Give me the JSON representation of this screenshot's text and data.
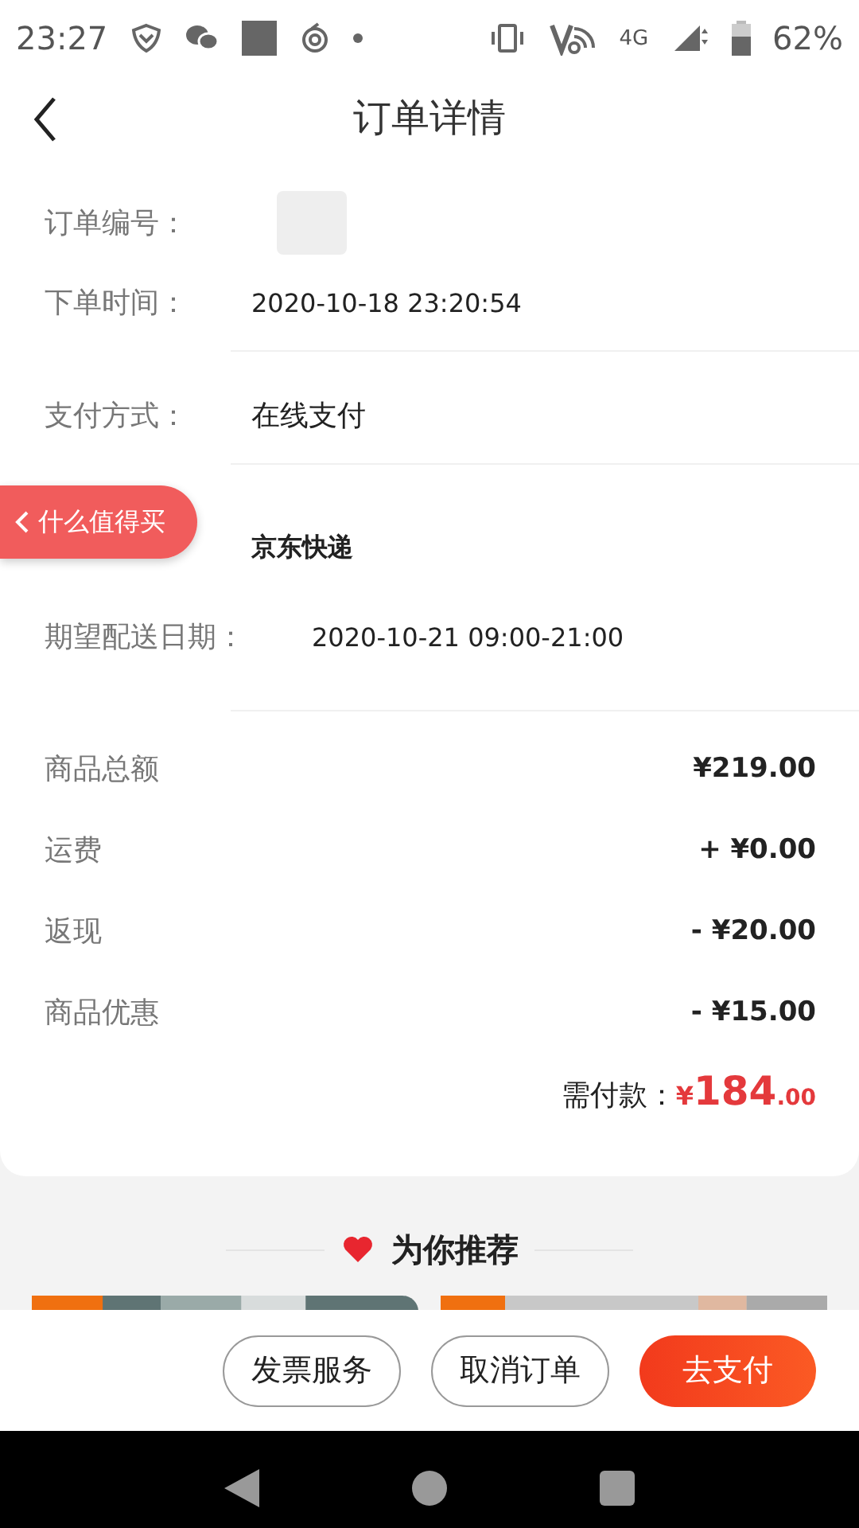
{
  "status_bar": {
    "time": "23:27",
    "network_type": "4G",
    "battery": "62%"
  },
  "header": {
    "title": "订单详情"
  },
  "details": {
    "groups": [
      [
        {
          "label": "订单编号：",
          "kind": "redacted"
        },
        {
          "label": "下单时间：",
          "value": "2020-10-18 23:20:54",
          "kind": "text"
        }
      ],
      [
        {
          "label": "支付方式：",
          "value": "在线支付",
          "kind": "plain"
        }
      ],
      [
        {
          "value": "京东快递",
          "kind": "bold"
        },
        {
          "label": "期望配送日期：",
          "value": "2020-10-21 09:00-21:00",
          "kind": "text"
        }
      ]
    ]
  },
  "amounts": [
    {
      "label": "商品总额",
      "value": "¥219.00"
    },
    {
      "label": "运费",
      "value": "+ ¥0.00"
    },
    {
      "label": "返现",
      "value": "- ¥20.00"
    },
    {
      "label": "商品优惠",
      "value": "- ¥15.00"
    }
  ],
  "total": {
    "label": "需付款：",
    "currency": "¥",
    "integer": "184",
    "decimal": ".00"
  },
  "floating_button": {
    "label": "什么值得买"
  },
  "recommend": {
    "title": "为你推荐"
  },
  "actions": [
    {
      "label": "发票服务",
      "kind": "outline"
    },
    {
      "label": "取消订单",
      "kind": "outline"
    },
    {
      "label": "去支付",
      "kind": "primary"
    }
  ]
}
